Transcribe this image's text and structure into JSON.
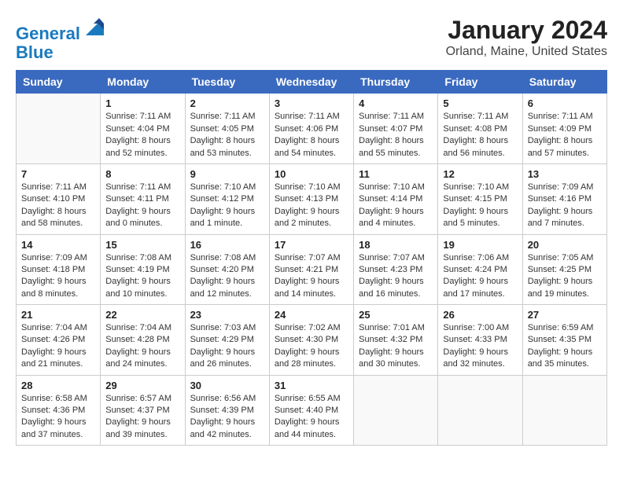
{
  "logo": {
    "line1": "General",
    "line2": "Blue"
  },
  "title": "January 2024",
  "subtitle": "Orland, Maine, United States",
  "days_of_week": [
    "Sunday",
    "Monday",
    "Tuesday",
    "Wednesday",
    "Thursday",
    "Friday",
    "Saturday"
  ],
  "weeks": [
    [
      {
        "day": "",
        "content": ""
      },
      {
        "day": "1",
        "content": "Sunrise: 7:11 AM\nSunset: 4:04 PM\nDaylight: 8 hours\nand 52 minutes."
      },
      {
        "day": "2",
        "content": "Sunrise: 7:11 AM\nSunset: 4:05 PM\nDaylight: 8 hours\nand 53 minutes."
      },
      {
        "day": "3",
        "content": "Sunrise: 7:11 AM\nSunset: 4:06 PM\nDaylight: 8 hours\nand 54 minutes."
      },
      {
        "day": "4",
        "content": "Sunrise: 7:11 AM\nSunset: 4:07 PM\nDaylight: 8 hours\nand 55 minutes."
      },
      {
        "day": "5",
        "content": "Sunrise: 7:11 AM\nSunset: 4:08 PM\nDaylight: 8 hours\nand 56 minutes."
      },
      {
        "day": "6",
        "content": "Sunrise: 7:11 AM\nSunset: 4:09 PM\nDaylight: 8 hours\nand 57 minutes."
      }
    ],
    [
      {
        "day": "7",
        "content": "Sunrise: 7:11 AM\nSunset: 4:10 PM\nDaylight: 8 hours\nand 58 minutes."
      },
      {
        "day": "8",
        "content": "Sunrise: 7:11 AM\nSunset: 4:11 PM\nDaylight: 9 hours\nand 0 minutes."
      },
      {
        "day": "9",
        "content": "Sunrise: 7:10 AM\nSunset: 4:12 PM\nDaylight: 9 hours\nand 1 minute."
      },
      {
        "day": "10",
        "content": "Sunrise: 7:10 AM\nSunset: 4:13 PM\nDaylight: 9 hours\nand 2 minutes."
      },
      {
        "day": "11",
        "content": "Sunrise: 7:10 AM\nSunset: 4:14 PM\nDaylight: 9 hours\nand 4 minutes."
      },
      {
        "day": "12",
        "content": "Sunrise: 7:10 AM\nSunset: 4:15 PM\nDaylight: 9 hours\nand 5 minutes."
      },
      {
        "day": "13",
        "content": "Sunrise: 7:09 AM\nSunset: 4:16 PM\nDaylight: 9 hours\nand 7 minutes."
      }
    ],
    [
      {
        "day": "14",
        "content": "Sunrise: 7:09 AM\nSunset: 4:18 PM\nDaylight: 9 hours\nand 8 minutes."
      },
      {
        "day": "15",
        "content": "Sunrise: 7:08 AM\nSunset: 4:19 PM\nDaylight: 9 hours\nand 10 minutes."
      },
      {
        "day": "16",
        "content": "Sunrise: 7:08 AM\nSunset: 4:20 PM\nDaylight: 9 hours\nand 12 minutes."
      },
      {
        "day": "17",
        "content": "Sunrise: 7:07 AM\nSunset: 4:21 PM\nDaylight: 9 hours\nand 14 minutes."
      },
      {
        "day": "18",
        "content": "Sunrise: 7:07 AM\nSunset: 4:23 PM\nDaylight: 9 hours\nand 16 minutes."
      },
      {
        "day": "19",
        "content": "Sunrise: 7:06 AM\nSunset: 4:24 PM\nDaylight: 9 hours\nand 17 minutes."
      },
      {
        "day": "20",
        "content": "Sunrise: 7:05 AM\nSunset: 4:25 PM\nDaylight: 9 hours\nand 19 minutes."
      }
    ],
    [
      {
        "day": "21",
        "content": "Sunrise: 7:04 AM\nSunset: 4:26 PM\nDaylight: 9 hours\nand 21 minutes."
      },
      {
        "day": "22",
        "content": "Sunrise: 7:04 AM\nSunset: 4:28 PM\nDaylight: 9 hours\nand 24 minutes."
      },
      {
        "day": "23",
        "content": "Sunrise: 7:03 AM\nSunset: 4:29 PM\nDaylight: 9 hours\nand 26 minutes."
      },
      {
        "day": "24",
        "content": "Sunrise: 7:02 AM\nSunset: 4:30 PM\nDaylight: 9 hours\nand 28 minutes."
      },
      {
        "day": "25",
        "content": "Sunrise: 7:01 AM\nSunset: 4:32 PM\nDaylight: 9 hours\nand 30 minutes."
      },
      {
        "day": "26",
        "content": "Sunrise: 7:00 AM\nSunset: 4:33 PM\nDaylight: 9 hours\nand 32 minutes."
      },
      {
        "day": "27",
        "content": "Sunrise: 6:59 AM\nSunset: 4:35 PM\nDaylight: 9 hours\nand 35 minutes."
      }
    ],
    [
      {
        "day": "28",
        "content": "Sunrise: 6:58 AM\nSunset: 4:36 PM\nDaylight: 9 hours\nand 37 minutes."
      },
      {
        "day": "29",
        "content": "Sunrise: 6:57 AM\nSunset: 4:37 PM\nDaylight: 9 hours\nand 39 minutes."
      },
      {
        "day": "30",
        "content": "Sunrise: 6:56 AM\nSunset: 4:39 PM\nDaylight: 9 hours\nand 42 minutes."
      },
      {
        "day": "31",
        "content": "Sunrise: 6:55 AM\nSunset: 4:40 PM\nDaylight: 9 hours\nand 44 minutes."
      },
      {
        "day": "",
        "content": ""
      },
      {
        "day": "",
        "content": ""
      },
      {
        "day": "",
        "content": ""
      }
    ]
  ]
}
